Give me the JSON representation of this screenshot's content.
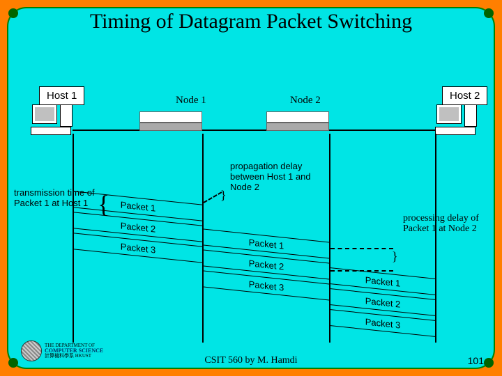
{
  "title": "Timing of Datagram Packet Switching",
  "labels": {
    "host1": "Host 1",
    "host2": "Host 2",
    "node1": "Node 1",
    "node2": "Node 2"
  },
  "annotations": {
    "tx": "transmission time of Packet 1 at Host 1",
    "prop": "propagation delay between Host 1 and Node 2",
    "proc": "processing delay of Packet 1 at Node 2"
  },
  "packets": {
    "p1": "Packet 1",
    "p2": "Packet 2",
    "p3": "Packet 3"
  },
  "logo": {
    "dept": "THE DEPARTMENT OF",
    "name": "COMPUTER SCIENCE",
    "school": "計算機科學系 HKUST"
  },
  "footer": "CSIT 560 by M. Hamdi",
  "page": "101"
}
